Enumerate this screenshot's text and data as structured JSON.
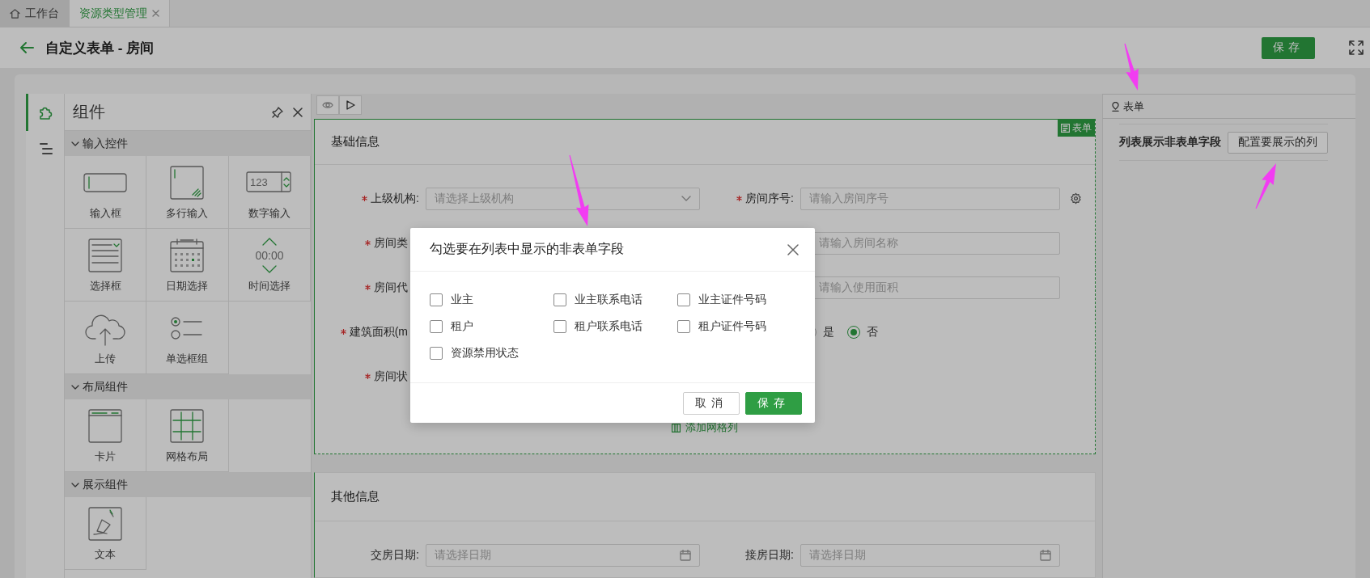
{
  "tabs": [
    {
      "label": "工作台",
      "kind": "home",
      "selected": false
    },
    {
      "label": "资源类型管理",
      "kind": "page",
      "selected": true
    }
  ],
  "page_header": {
    "title": "自定义表单 - 房间",
    "save_button": "保存"
  },
  "rail": [
    {
      "kind": "components",
      "selected": true
    },
    {
      "kind": "outline",
      "selected": false
    }
  ],
  "component_panel": {
    "title": "组件",
    "groups": [
      {
        "title": "输入控件",
        "expanded": true,
        "items": [
          {
            "label": "输入框",
            "kind": "input"
          },
          {
            "label": "多行输入",
            "kind": "textarea"
          },
          {
            "label": "数字输入",
            "kind": "number",
            "icon_text": "123"
          },
          {
            "label": "选择框",
            "kind": "select"
          },
          {
            "label": "日期选择",
            "kind": "date"
          },
          {
            "label": "时间选择",
            "kind": "time",
            "icon_text": "00:00"
          },
          {
            "label": "上传",
            "kind": "upload"
          },
          {
            "label": "单选框组",
            "kind": "radio"
          }
        ]
      },
      {
        "title": "布局组件",
        "expanded": true,
        "items": [
          {
            "label": "卡片",
            "kind": "card"
          },
          {
            "label": "网格布局",
            "kind": "grid"
          }
        ]
      },
      {
        "title": "展示组件",
        "expanded": true,
        "items": [
          {
            "label": "文本",
            "kind": "text"
          }
        ]
      }
    ]
  },
  "canvas": {
    "form_badge": "表单",
    "sections": [
      {
        "title": "基础信息",
        "rows": [
          {
            "left": {
              "label": "上级机构:",
              "required": true,
              "kind": "select",
              "placeholder": "请选择上级机构"
            },
            "right": {
              "label": "房间序号:",
              "required": true,
              "kind": "input",
              "placeholder": "请输入房间序号",
              "settings": true
            }
          },
          {
            "left": {
              "label": "房间类",
              "required": true
            },
            "right": {
              "kind": "input",
              "placeholder": "请输入房间名称"
            }
          },
          {
            "left": {
              "label": "房间代",
              "required": true
            },
            "right": {
              "kind": "input",
              "placeholder": "请输入使用面积"
            }
          },
          {
            "left": {
              "label": "建筑面积(m",
              "required": true
            },
            "right": {
              "kind": "radio",
              "options": [
                {
                  "label": "是",
                  "selected": false
                },
                {
                  "label": "否",
                  "selected": true
                }
              ]
            }
          },
          {
            "left": {
              "label": "房间状",
              "required": true
            }
          }
        ],
        "add_link": "添加网格列"
      },
      {
        "title": "其他信息",
        "rows": [
          {
            "left": {
              "label": "交房日期:",
              "required": false,
              "kind": "date",
              "placeholder": "请选择日期"
            },
            "right": {
              "label": "接房日期:",
              "required": false,
              "kind": "date",
              "placeholder": "请选择日期"
            }
          }
        ]
      }
    ]
  },
  "right_panel": {
    "title": "表单",
    "setting_label": "列表展示非表单字段",
    "setting_button": "配置要展示的列"
  },
  "modal": {
    "title": "勾选要在列表中显示的非表单字段",
    "options": [
      {
        "label": "业主",
        "checked": false
      },
      {
        "label": "业主联系电话",
        "checked": false
      },
      {
        "label": "业主证件号码",
        "checked": false
      },
      {
        "label": "租户",
        "checked": false
      },
      {
        "label": "租户联系电话",
        "checked": false
      },
      {
        "label": "租户证件号码",
        "checked": false
      },
      {
        "label": "资源禁用状态",
        "checked": false
      }
    ],
    "buttons": [
      {
        "label": "取消",
        "kind": "default"
      },
      {
        "label": "保存",
        "kind": "primary"
      }
    ]
  }
}
